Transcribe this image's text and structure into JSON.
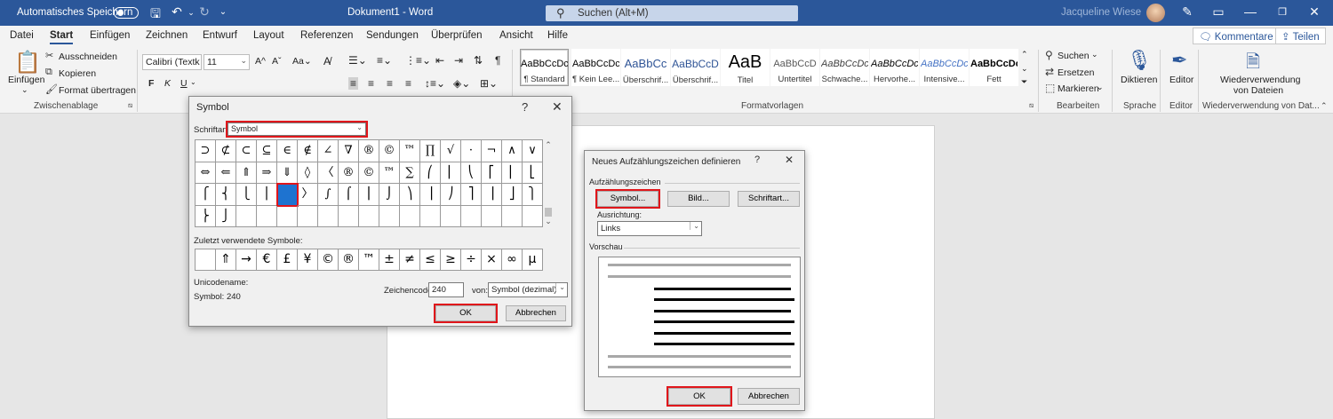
{
  "titlebar": {
    "autosave_label": "Automatisches Speichern",
    "doc_title": "Dokument1  -  Word",
    "search_placeholder": "Suchen (Alt+M)",
    "user_name": "Jacqueline Wiese"
  },
  "tabs": [
    "Datei",
    "Start",
    "Einfügen",
    "Zeichnen",
    "Entwurf",
    "Layout",
    "Referenzen",
    "Sendungen",
    "Überprüfen",
    "Ansicht",
    "Hilfe"
  ],
  "active_tab": "Start",
  "top_buttons": {
    "comments": "Kommentare",
    "share": "Teilen"
  },
  "ribbon": {
    "clipboard": {
      "paste": "Einfügen",
      "cut": "Ausschneiden",
      "copy": "Kopieren",
      "format_painter": "Format übertragen",
      "group": "Zwischenablage"
    },
    "font": {
      "name": "Calibri (Textk",
      "size": "11",
      "bold": "F",
      "italic": "K",
      "underline": "U"
    },
    "styles": {
      "items": [
        {
          "preview": "AaBbCcDc",
          "name": "¶ Standard"
        },
        {
          "preview": "AaBbCcDc",
          "name": "¶ Kein Lee..."
        },
        {
          "preview": "AaBbCc",
          "name": "Überschrif..."
        },
        {
          "preview": "AaBbCcD",
          "name": "Überschrif..."
        },
        {
          "preview": "AaB",
          "name": "Titel"
        },
        {
          "preview": "AaBbCcD",
          "name": "Untertitel"
        },
        {
          "preview": "AaBbCcDc",
          "name": "Schwache..."
        },
        {
          "preview": "AaBbCcDc",
          "name": "Hervorhe..."
        },
        {
          "preview": "AaBbCcDc",
          "name": "Intensive..."
        },
        {
          "preview": "AaBbCcDc",
          "name": "Fett"
        }
      ],
      "group": "Formatvorlagen"
    },
    "editing": {
      "find": "Suchen",
      "replace": "Ersetzen",
      "select": "Markieren",
      "group": "Bearbeiten"
    },
    "voice": {
      "dictate": "Diktieren",
      "group": "Sprache"
    },
    "editor": {
      "label": "Editor",
      "group": "Editor"
    },
    "reuse": {
      "label_1": "Wiederverwendung",
      "label_2": "von Dateien",
      "group": "Wiederverwendung von Dat..."
    }
  },
  "symbol_dialog": {
    "title": "Symbol",
    "font_label": "Schriftart:",
    "font_value": "Symbol",
    "grid": [
      [
        "⊃",
        "⊄",
        "⊂",
        "⊆",
        "∈",
        "∉",
        "∠",
        "∇",
        "®",
        "©",
        "™",
        "∏",
        "√",
        "·",
        "¬",
        "∧",
        "∨"
      ],
      [
        "⇔",
        "⇐",
        "⇑",
        "⇒",
        "⇓",
        "◊",
        "〈",
        "®",
        "©",
        "™",
        "∑",
        "⎛",
        "⎜",
        "⎝",
        "⎡",
        "⎢",
        "⎣"
      ],
      [
        "⎧",
        "⎨",
        "⎩",
        "⎪",
        "",
        "〉",
        "∫",
        "⌠",
        "⎮",
        "⌡",
        "⎞",
        "⎟",
        "⎠",
        "⎤",
        "⎥",
        "⎦",
        "⎫"
      ],
      [
        "⎬",
        "⎭",
        "",
        "",
        "",
        "",
        "",
        "",
        "",
        "",
        "",
        "",
        "",
        "",
        "",
        "",
        ""
      ]
    ],
    "recent_label": "Zuletzt verwendete Symbole:",
    "recent": [
      "",
      "⇑",
      "→",
      "€",
      "£",
      "¥",
      "©",
      "®",
      "™",
      "±",
      "≠",
      "≤",
      "≥",
      "÷",
      "×",
      "∞",
      "µ"
    ],
    "unicode_name_label": "Unicodename:",
    "symbol_code_text": "Symbol: 240",
    "charcode_label": "Zeichencode:",
    "charcode_value": "240",
    "from_label": "von:",
    "from_value": "Symbol (dezimal)",
    "ok": "OK",
    "cancel": "Abbrechen"
  },
  "bullet_dialog": {
    "title": "Neues Aufzählungszeichen definieren",
    "section_label": "Aufzählungszeichen",
    "symbol_btn": "Symbol...",
    "image_btn": "Bild...",
    "font_btn": "Schriftart...",
    "alignment_label": "Ausrichtung:",
    "alignment_value": "Links",
    "preview_label": "Vorschau",
    "preview_bullet": "",
    "ok": "OK",
    "cancel": "Abbrechen"
  }
}
